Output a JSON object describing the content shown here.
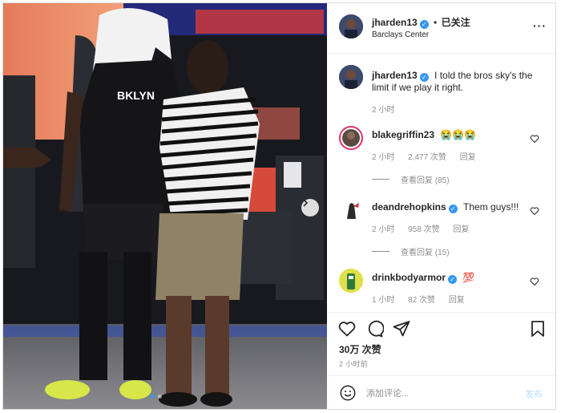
{
  "post": {
    "author": "jharden13",
    "follow_label": "已关注",
    "follow_dot": "•",
    "location": "Barclays Center",
    "more_label": "···"
  },
  "caption": {
    "username": "jharden13",
    "text": "I told the bros sky's the limit if we play it right.",
    "time": "2 小时"
  },
  "comments": [
    {
      "username": "blakegriffin23",
      "verified": false,
      "text": "😭😭😭",
      "time": "2 小时",
      "likes": "2,477 次赞",
      "reply": "回复",
      "view_replies": "查看回复 (85)"
    },
    {
      "username": "deandrehopkins",
      "verified": true,
      "text": "Them guys!!!",
      "time": "2 小时",
      "likes": "958 次赞",
      "reply": "回复",
      "view_replies": "查看回复 (15)"
    },
    {
      "username": "drinkbodyarmor",
      "verified": true,
      "text": "💯",
      "time": "1 小时",
      "likes": "82 次赞",
      "reply": "回复"
    }
  ],
  "likes_count": "30万 次赞",
  "posted_time": "2 小时前",
  "add_comment": {
    "placeholder": "添加评论...",
    "post_label": "发布"
  },
  "photo": {
    "jersey_text": "BKLYN"
  },
  "icons": {
    "verified": "verified-badge-icon",
    "like": "heart-icon",
    "comment": "comment-bubble-icon",
    "share": "paper-plane-icon",
    "save": "bookmark-icon",
    "emoji": "smiley-icon",
    "next": "chevron-right-icon"
  },
  "colors": {
    "accent": "#3897f0",
    "muted": "#8e8e8e",
    "text": "#262626",
    "post_disabled": "#b3dbff"
  }
}
